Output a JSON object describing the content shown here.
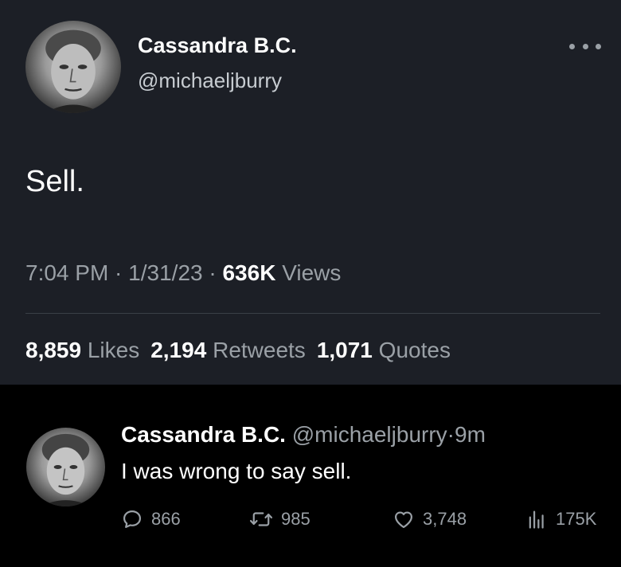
{
  "tweet": {
    "author_name": "Cassandra B.C.",
    "author_handle": "@michaeljburry",
    "text": "Sell.",
    "time": "7:04 PM",
    "sep1": " · ",
    "date": "1/31/23",
    "sep2": " · ",
    "views_count": "636K",
    "views_label": "Views",
    "likes_count": "8,859",
    "likes_label": "Likes",
    "retweets_count": "2,194",
    "retweets_label": "Retweets",
    "quotes_count": "1,071",
    "quotes_label": "Quotes",
    "more_icon": "more-horizontal-icon"
  },
  "reply": {
    "author_name": "Cassandra B.C.",
    "author_handle": "@michaeljburry",
    "sep": "·",
    "time_ago": "9m",
    "text": "I was wrong to say sell.",
    "actions": {
      "replies": "866",
      "retweets": "985",
      "likes": "3,748",
      "views": "175K"
    }
  },
  "colors": {
    "top_background": "#1c1f26",
    "bottom_background": "#000000",
    "primary_text": "#ffffff",
    "secondary_text": "#9aa0a6"
  }
}
